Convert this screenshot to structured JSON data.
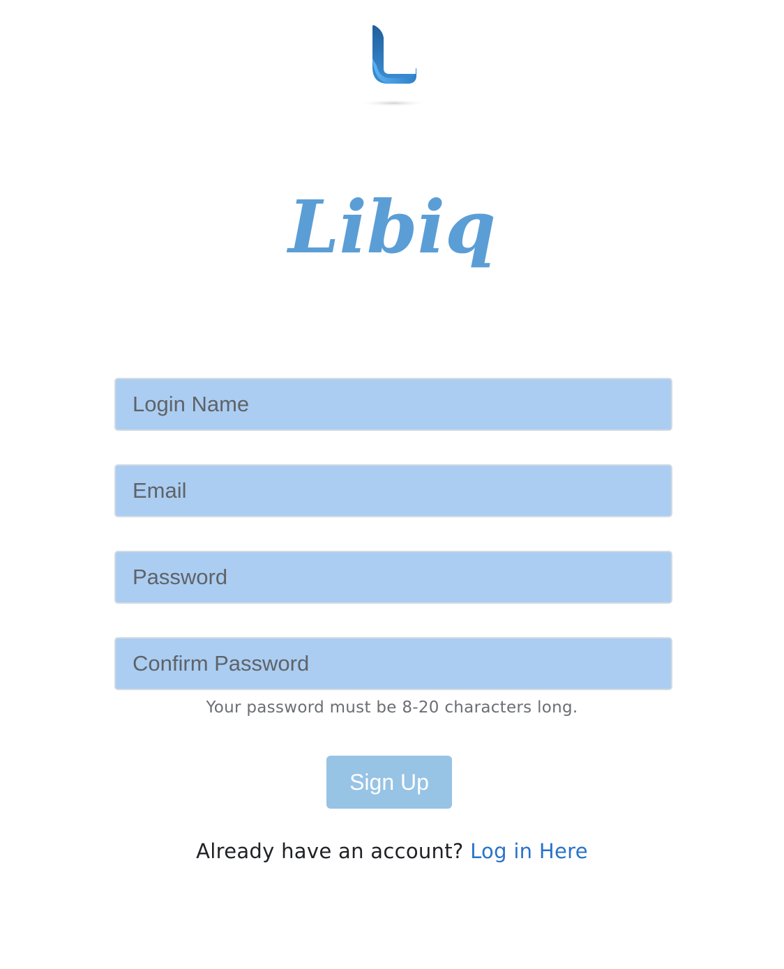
{
  "brand": {
    "logo_icon": "letter-l-logo-icon",
    "wordmark": "Libiq",
    "colors": {
      "logo_dark": "#1f5f9e",
      "logo_light": "#4fa3e8",
      "wordmark": "#5b9ed6"
    }
  },
  "form": {
    "login_name": {
      "placeholder": "Login Name",
      "value": ""
    },
    "email": {
      "placeholder": "Email",
      "value": ""
    },
    "password": {
      "placeholder": "Password",
      "value": ""
    },
    "confirm_password": {
      "placeholder": "Confirm Password",
      "value": ""
    },
    "password_hint": "Your password must be 8-20 characters long.",
    "submit_label": "Sign Up",
    "field_color": "#abcdf2",
    "button_color": "#97c3e5"
  },
  "footer": {
    "prompt": "Already have an account? ",
    "link_label": "Log in Here",
    "link_color": "#2a72c9"
  }
}
